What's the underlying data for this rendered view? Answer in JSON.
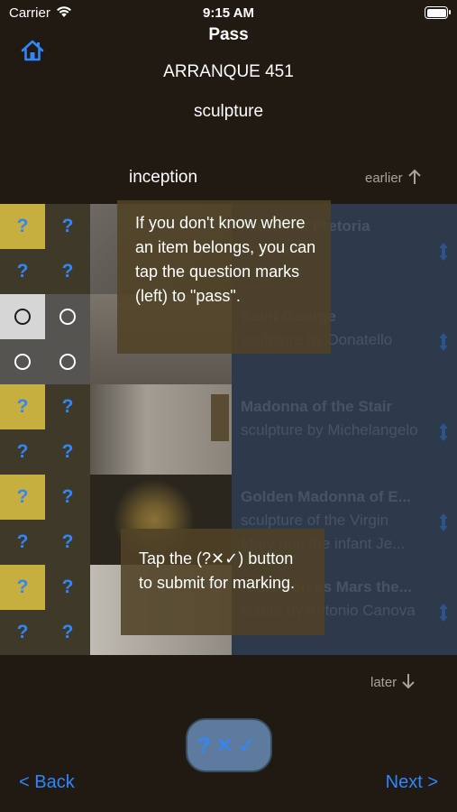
{
  "status_bar": {
    "carrier": "Carrier",
    "time": "9:15 AM"
  },
  "header": {
    "title": "Pass",
    "subtitle": "ARRANQUE 451",
    "category": "sculpture"
  },
  "list": {
    "column_label": "inception",
    "earlier_label": "earlier",
    "later_label": "later",
    "rows": [
      {
        "title": "Madonna Pretoria",
        "description": "sculpture",
        "answer_cells": [
          "?",
          "?",
          "?",
          "?"
        ],
        "thumb_colors": [
          "#6d6a63",
          "#4a4640"
        ]
      },
      {
        "title": "Saint George",
        "description": "sculpture by Donatello",
        "answer_cells": [
          "○",
          "○",
          "○",
          "○"
        ],
        "thumb_colors": [
          "#7a746a",
          "#5b564e"
        ]
      },
      {
        "title": "Madonna of the Stair",
        "description": "sculpture by Michelangelo",
        "answer_cells": [
          "?",
          "?",
          "?",
          "?"
        ],
        "thumb_colors": [
          "#a39d92",
          "#8a8479"
        ]
      },
      {
        "title": "Golden Madonna of E...",
        "description": "sculpture of the Virgin Mary and the infant Je...",
        "answer_cells": [
          "?",
          "?",
          "?",
          "?"
        ],
        "thumb_colors": [
          "#2a261e",
          "#6d5a2c"
        ]
      },
      {
        "title": "Napoleon as Mars the...",
        "description": "statue by Antonio Canova",
        "answer_cells": [
          "?",
          "?",
          "?",
          "?"
        ],
        "thumb_colors": [
          "#bfbcb4",
          "#8e8b84"
        ]
      }
    ]
  },
  "tips": {
    "pass_tip": "If you don't know where an item belongs, you can tap the question marks (left) to \"pass\".",
    "submit_tip": "Tap the (?✕✓) button to submit for marking."
  },
  "submit_button": {
    "label": "?✕✓"
  },
  "nav": {
    "back": "< Back",
    "next": "Next >"
  },
  "colors": {
    "accent": "#2f86ff",
    "background": "#201a12",
    "yellow_cell": "#c6ae3f",
    "info_panel": "#2c3a4c",
    "tip_bg": "#504226"
  }
}
